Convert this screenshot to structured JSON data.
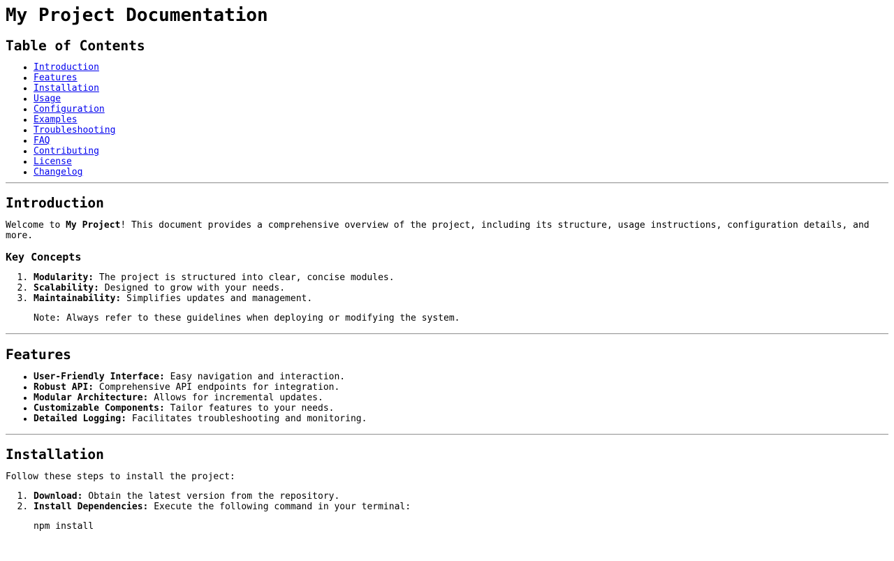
{
  "title": "My Project Documentation",
  "toc": {
    "heading": "Table of Contents",
    "items": [
      "Introduction",
      "Features",
      "Installation",
      "Usage",
      "Configuration",
      "Examples",
      "Troubleshooting",
      "FAQ",
      "Contributing",
      "License",
      "Changelog"
    ]
  },
  "introduction": {
    "heading": "Introduction",
    "welcome_prefix": "Welcome to ",
    "project_name": "My Project",
    "welcome_suffix": "! This document provides a comprehensive overview of the project, including its structure, usage instructions, configuration details, and more.",
    "key_concepts": {
      "heading": "Key Concepts",
      "items": [
        {
          "term": "Modularity:",
          "text": " The project is structured into clear, concise modules."
        },
        {
          "term": "Scalability:",
          "text": " Designed to grow with your needs."
        },
        {
          "term": "Maintainability:",
          "text": " Simplifies updates and management."
        }
      ],
      "note": "Note: Always refer to these guidelines when deploying or modifying the system."
    }
  },
  "features": {
    "heading": "Features",
    "items": [
      {
        "term": "User-Friendly Interface:",
        "text": " Easy navigation and interaction."
      },
      {
        "term": "Robust API:",
        "text": " Comprehensive API endpoints for integration."
      },
      {
        "term": "Modular Architecture:",
        "text": " Allows for incremental updates."
      },
      {
        "term": "Customizable Components:",
        "text": " Tailor features to your needs."
      },
      {
        "term": "Detailed Logging:",
        "text": " Facilitates troubleshooting and monitoring."
      }
    ]
  },
  "installation": {
    "heading": "Installation",
    "intro": "Follow these steps to install the project:",
    "steps": [
      {
        "term": "Download:",
        "text": " Obtain the latest version from the repository."
      },
      {
        "term": "Install Dependencies:",
        "text": " Execute the following command in your terminal:"
      }
    ],
    "command": "npm install"
  }
}
